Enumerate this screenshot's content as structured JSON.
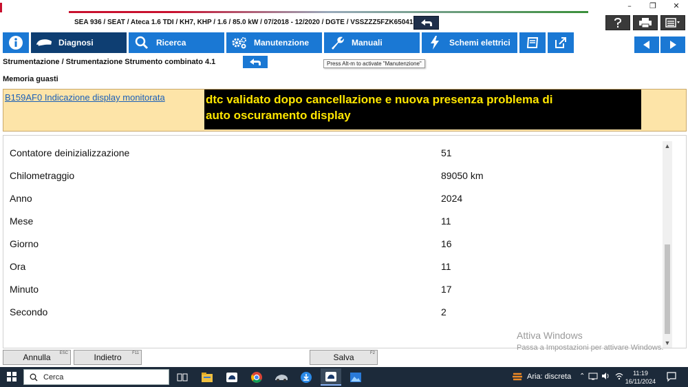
{
  "window": {
    "minimize": "–",
    "restore": "❐",
    "close": "✕"
  },
  "vehicle_info": "SEA 936 / SEAT / Ateca 1.6 TDI / KH7, KHP / 1.6 / 85.0 kW / 07/2018 - 12/2020 / DGTE / VSSZZZ5FZK6504133",
  "nav": {
    "items": [
      {
        "label": "",
        "icon": "info-icon"
      },
      {
        "label": "Diagnosi",
        "icon": "car-icon",
        "active": true
      },
      {
        "label": "Ricerca",
        "icon": "search-icon"
      },
      {
        "label": "Manutenzione",
        "icon": "gears-icon"
      },
      {
        "label": "Manuali",
        "icon": "wrench-icon"
      },
      {
        "label": "Schemi elettrici",
        "icon": "lightning-icon"
      },
      {
        "label": "",
        "icon": "book-icon"
      },
      {
        "label": "",
        "icon": "external-link-icon"
      }
    ]
  },
  "breadcrumb": "Strumentazione / Strumentazione Strumento combinato 4.1",
  "tooltip": "Press Alt-m to activate \"Manutenzione\"",
  "section_title": "Memoria guasti",
  "fault": {
    "code_link": "B159AF0 Indicazione display monitorata",
    "description_line1": "dtc validato dopo cancellazione e nuova presenza problema di",
    "description_line2": "auto oscuramento display"
  },
  "data_rows": [
    {
      "label": "Contatore deinizializzazione",
      "value": "51"
    },
    {
      "label": "Chilometraggio",
      "value": "89050 km"
    },
    {
      "label": "Anno",
      "value": "2024"
    },
    {
      "label": "Mese",
      "value": "11"
    },
    {
      "label": "Giorno",
      "value": "16"
    },
    {
      "label": "Ora",
      "value": "11"
    },
    {
      "label": "Minuto",
      "value": "17"
    },
    {
      "label": "Secondo",
      "value": "2"
    }
  ],
  "watermark": {
    "title": "Attiva Windows",
    "subtitle": "Passa a Impostazioni per attivare Windows."
  },
  "buttons": {
    "annulla": {
      "label": "Annulla",
      "key": "ESC"
    },
    "indietro": {
      "label": "Indietro",
      "key": "F11"
    },
    "salva": {
      "label": "Salva",
      "key": "F2"
    }
  },
  "taskbar": {
    "search_placeholder": "Cerca",
    "weather": "Aria: discreta",
    "time": "11:19",
    "date": "16/11/2024"
  },
  "colors": {
    "nav_blue": "#1a78d4",
    "nav_active": "#0e3e72",
    "fault_bg": "#fde4a8",
    "fault_desc_bg": "#000000",
    "fault_desc_text": "#ffe600",
    "link": "#1a5fb8"
  }
}
